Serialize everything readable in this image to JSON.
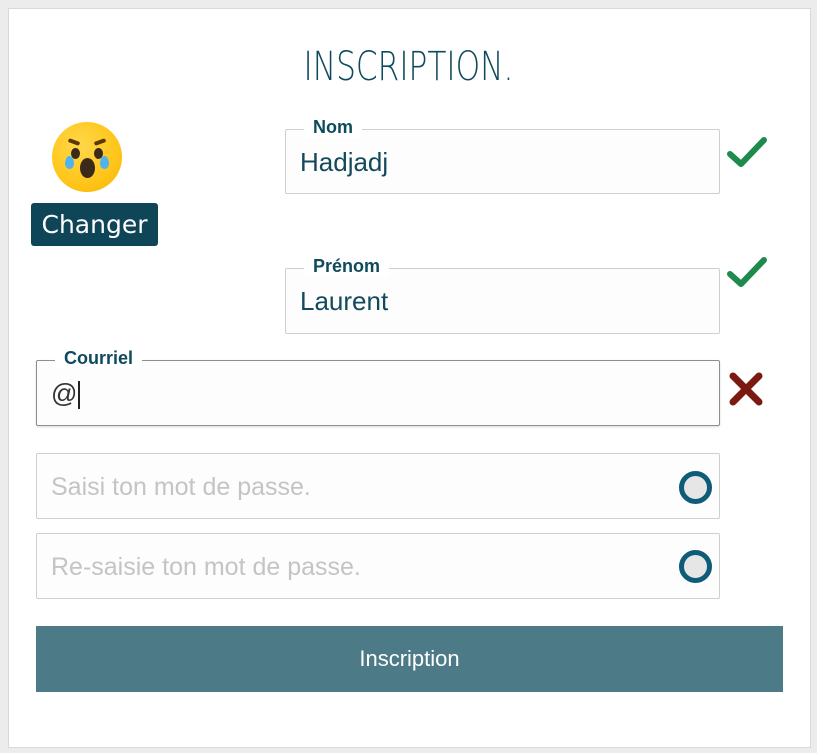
{
  "form": {
    "title": "INSCRIPTION.",
    "avatar_icon": "crying-face-icon",
    "change_button_label": "Changer",
    "fields": {
      "nom": {
        "label": "Nom",
        "value": "Hadjadj",
        "status": "valid"
      },
      "prenom": {
        "label": "Prénom",
        "value": "Laurent",
        "status": "valid"
      },
      "courriel": {
        "label": "Courriel",
        "value": "@",
        "status": "invalid"
      },
      "password": {
        "placeholder": "Saisi ton mot de passe.",
        "value": ""
      },
      "password_confirm": {
        "placeholder": "Re-saisie ton mot de passe.",
        "value": ""
      }
    },
    "submit_label": "Inscription"
  },
  "colors": {
    "primary": "#0e4557",
    "title": "#0f4a5c",
    "valid": "#1e8a4c",
    "invalid": "#7a1a10",
    "submit": "#4c7a87",
    "placeholder": "#c4c4c4"
  }
}
